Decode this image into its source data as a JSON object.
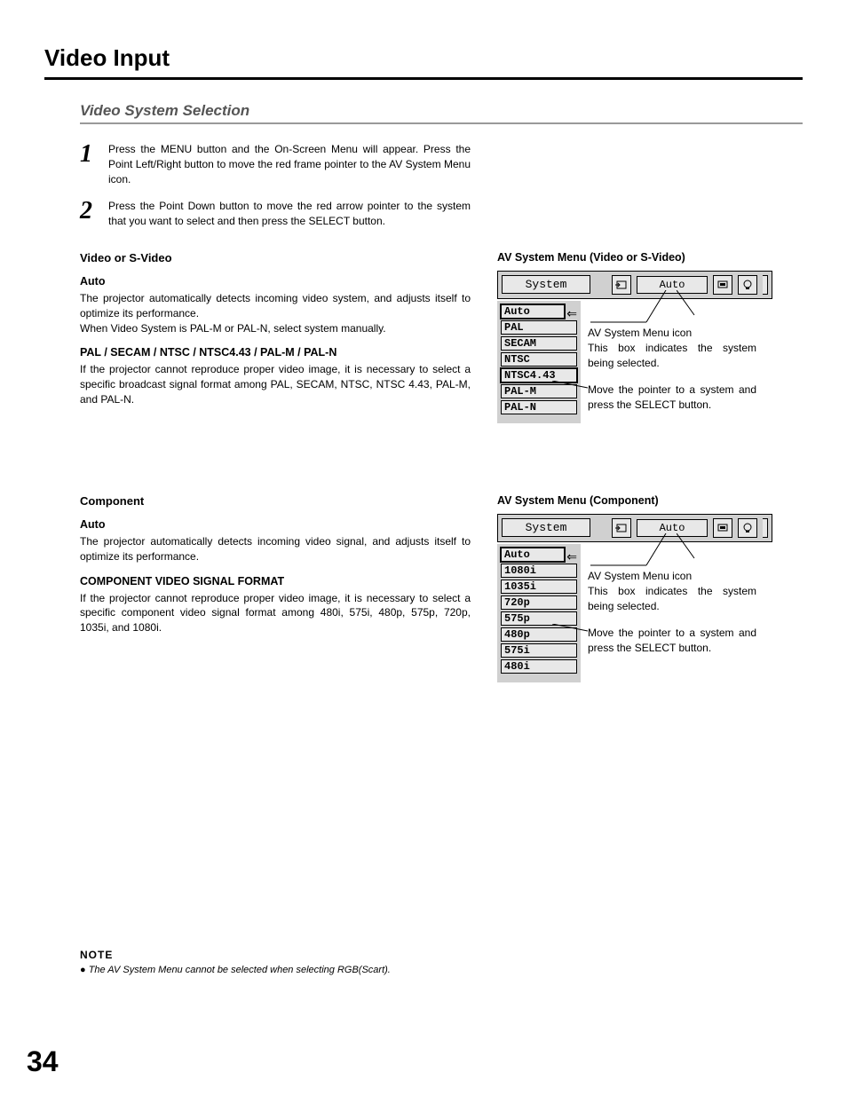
{
  "page": {
    "title": "Video Input",
    "section": "Video System Selection",
    "number": "34"
  },
  "steps": [
    {
      "num": "1",
      "text": "Press the MENU button and the On-Screen Menu will appear. Press the Point Left/Right button to move the red frame pointer to the AV System Menu icon."
    },
    {
      "num": "2",
      "text": "Press the Point Down button to move the red arrow pointer to the system that you want to select and then press the SELECT button."
    }
  ],
  "block1": {
    "heading": "Video or S-Video",
    "sub1_title": "Auto",
    "sub1_text1": "The projector automatically detects incoming video system, and adjusts itself to optimize its performance.",
    "sub1_text2": "When Video System is PAL-M or PAL-N, select system manually.",
    "sub2_title": "PAL / SECAM / NTSC / NTSC4.43 / PAL-M / PAL-N",
    "sub2_text": "If the projector cannot reproduce proper video image, it is necessary to select a specific broadcast signal format among PAL, SECAM, NTSC, NTSC 4.43, PAL-M, and PAL-N."
  },
  "block2": {
    "heading": "Component",
    "sub1_title": "Auto",
    "sub1_text": "The projector automatically detects incoming video signal, and adjusts itself to optimize its performance.",
    "sub2_title": "COMPONENT VIDEO SIGNAL FORMAT",
    "sub2_text": "If the projector cannot reproduce proper video image, it is necessary to select a specific component video signal format among 480i, 575i, 480p, 575p, 720p, 1035i, and 1080i."
  },
  "osd1": {
    "title": "AV System Menu (Video or S-Video)",
    "label": "System",
    "current": "Auto",
    "items": [
      "Auto",
      "PAL",
      "SECAM",
      "NTSC",
      "NTSC4.43",
      "PAL-M",
      "PAL-N"
    ],
    "desc1a": "AV System Menu icon",
    "desc1b": "This box indicates the system being selected.",
    "desc2": "Move the pointer to a system and press the SELECT button."
  },
  "osd2": {
    "title": "AV System Menu (Component)",
    "label": "System",
    "current": "Auto",
    "items": [
      "Auto",
      "1080i",
      "1035i",
      "720p",
      "575p",
      "480p",
      "575i",
      "480i"
    ],
    "desc1a": "AV System Menu icon",
    "desc1b": "This box indicates the system being selected.",
    "desc2": "Move the pointer to a system and press the SELECT button."
  },
  "note": {
    "label": "NOTE",
    "text": "The AV System Menu cannot be selected when selecting RGB(Scart)."
  }
}
